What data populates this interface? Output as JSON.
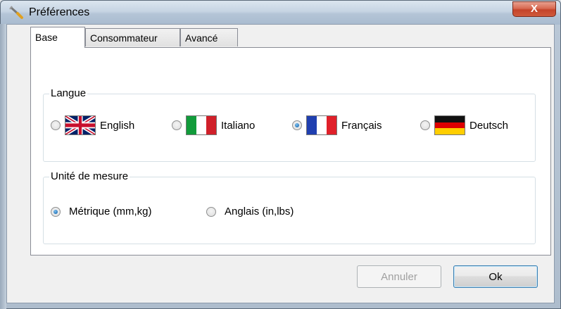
{
  "window": {
    "title": "Préférences",
    "close_label": "X"
  },
  "tabs": [
    {
      "label": "Base",
      "active": true
    },
    {
      "label": "Consommateur",
      "active": false
    },
    {
      "label": "Avancé",
      "active": false
    }
  ],
  "langue": {
    "legend": "Langue",
    "options": [
      {
        "label": "English",
        "checked": false,
        "flag": "uk-flag"
      },
      {
        "label": "Italiano",
        "checked": false,
        "flag": "italy-flag"
      },
      {
        "label": "Français",
        "checked": true,
        "flag": "france-flag"
      },
      {
        "label": "Deutsch",
        "checked": false,
        "flag": "germany-flag"
      }
    ]
  },
  "unite": {
    "legend": "Unité de mesure",
    "options": [
      {
        "label": "Métrique (mm,kg)",
        "checked": true
      },
      {
        "label": "Anglais (in,lbs)",
        "checked": false
      }
    ]
  },
  "buttons": {
    "cancel_label": "Annuler",
    "cancel_enabled": false,
    "ok_label": "Ok"
  },
  "colors": {
    "radio_checked": "#1f6fb2",
    "close_button": "#c4432a"
  }
}
